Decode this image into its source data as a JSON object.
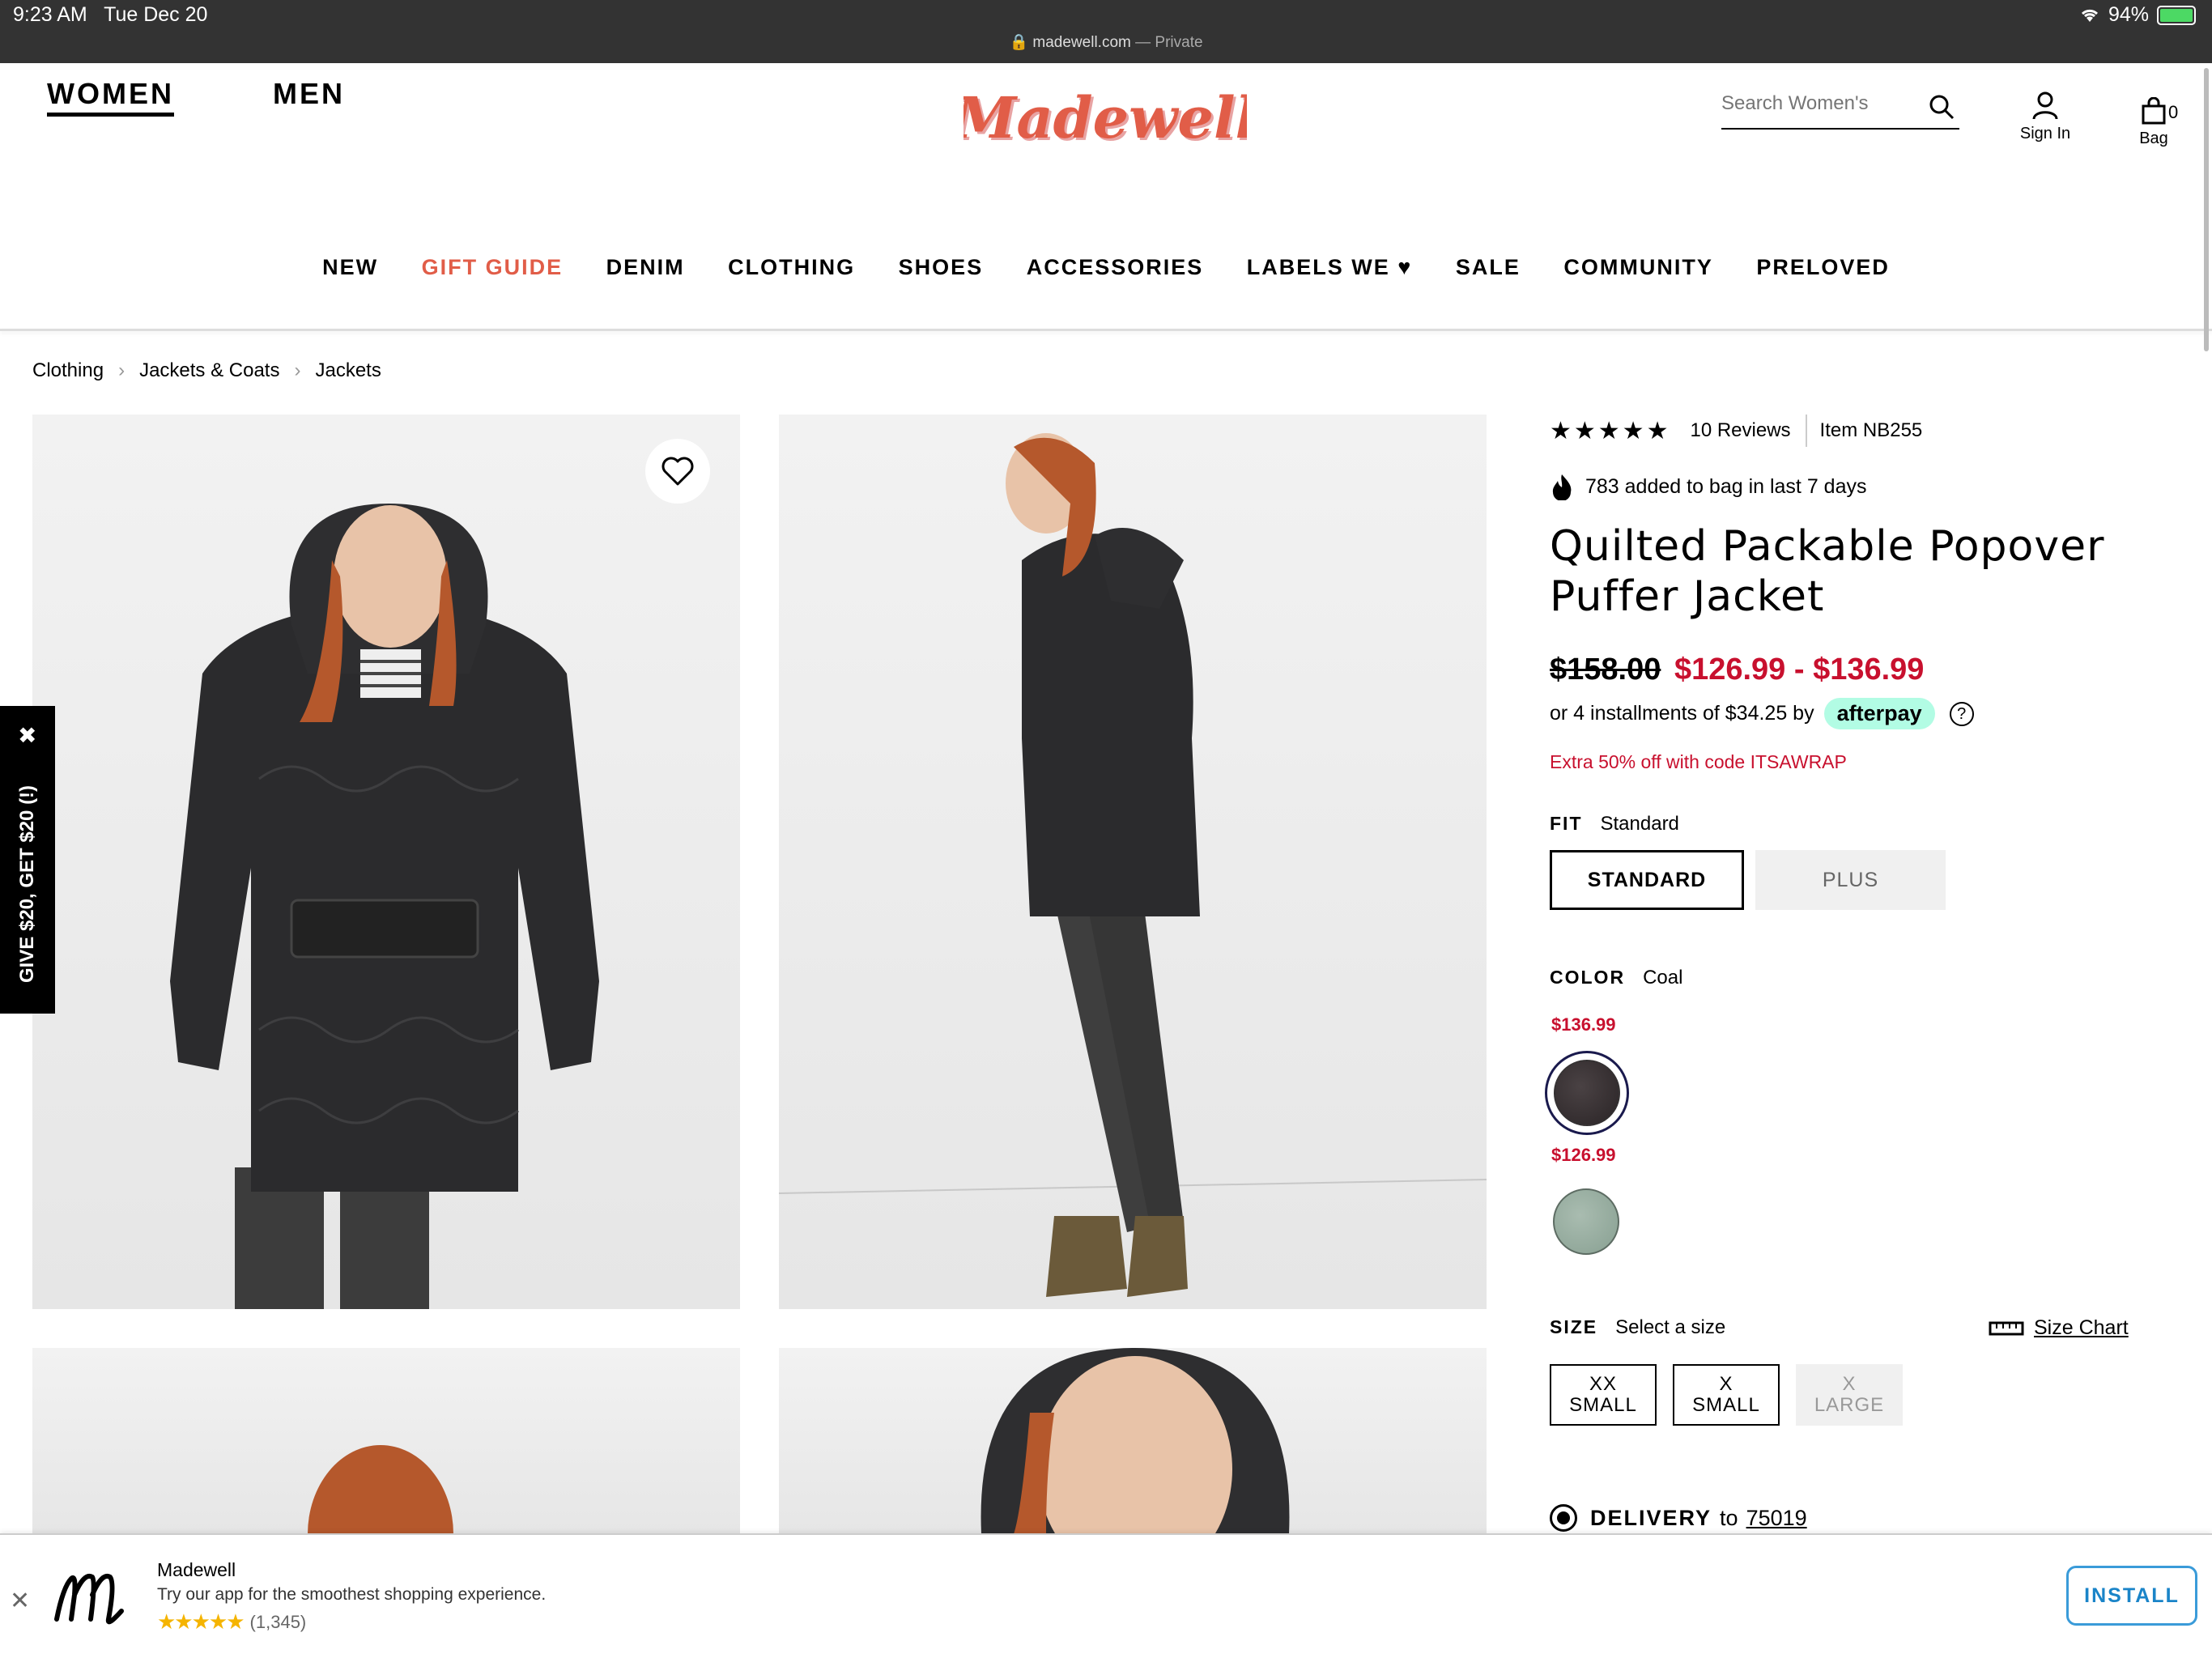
{
  "status_bar": {
    "time": "9:23 AM",
    "date": "Tue Dec 20",
    "url": "madewell.com",
    "private_label": "— Private",
    "battery": "94%"
  },
  "header": {
    "nav_women": "WOMEN",
    "nav_men": "MEN",
    "logo_text": "Madewell",
    "search_placeholder": "Search Women's",
    "sign_in": "Sign In",
    "bag_label": "Bag",
    "bag_count": "0"
  },
  "categories": [
    "NEW",
    "GIFT GUIDE",
    "DENIM",
    "CLOTHING",
    "SHOES",
    "ACCESSORIES",
    "LABELS WE ♥",
    "SALE",
    "COMMUNITY",
    "PRELOVED"
  ],
  "breadcrumb": [
    "Clothing",
    "Jackets & Coats",
    "Jackets"
  ],
  "referral": {
    "text": "GIVE $20, GET $20 (!)",
    "close": "✖"
  },
  "product": {
    "stars": "★★★★★",
    "rating": 4.5,
    "reviews": "10 Reviews",
    "item": "Item NB255",
    "trending": "783 added to bag in last 7 days",
    "title": "Quilted Packable Popover Puffer Jacket",
    "original_price": "$158.00",
    "sale_price": "$126.99 - $136.99",
    "afterpay_text": "or 4 installments of $34.25 by",
    "afterpay_brand": "afterpay",
    "afterpay_info": "?",
    "promo": "Extra 50% off with code ITSAWRAP",
    "fit_label": "FIT",
    "fit_value": "Standard",
    "fit_options": [
      "STANDARD",
      "PLUS"
    ],
    "color_label": "COLOR",
    "color_value": "Coal",
    "swatches": [
      {
        "price": "$136.99",
        "color": "#3a3234",
        "name": "Coal"
      },
      {
        "price": "$126.99",
        "color": "#98ae9f",
        "name": "Sage"
      }
    ],
    "size_label": "SIZE",
    "size_value": "Select a size",
    "size_chart": "Size Chart",
    "sizes": [
      {
        "line1": "XX",
        "line2": "SMALL"
      },
      {
        "line1": "X",
        "line2": "SMALL"
      },
      {
        "line1": "X",
        "line2": "LARGE"
      }
    ],
    "delivery_label": "DELIVERY",
    "delivery_to": "to",
    "delivery_zip": "75019"
  },
  "app_banner": {
    "name": "Madewell",
    "tagline": "Try our app for the smoothest shopping experience.",
    "stars": "★★★★★",
    "rating_count": "(1,345)",
    "install": "INSTALL",
    "close": "✕"
  },
  "colors": {
    "sale_red": "#c8102e",
    "gift_guide": "#e15d48",
    "afterpay_mint": "#b2fce4",
    "install_blue": "#1a84c8"
  }
}
